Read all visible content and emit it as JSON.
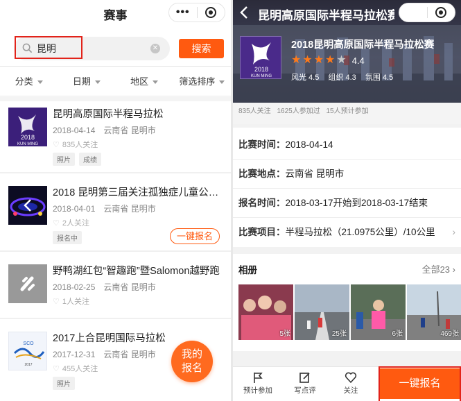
{
  "left": {
    "nav_title": "赛事",
    "capsule_more": "•••",
    "search": {
      "value": "昆明",
      "button": "搜索"
    },
    "filters": [
      "分类",
      "日期",
      "地区",
      "筛选排序"
    ],
    "events": [
      {
        "title": "昆明高原国际半程马拉松",
        "date": "2018-04-14",
        "location": "云南省 昆明市",
        "followers": "835人关注",
        "tags": [
          "照片",
          "成绩"
        ]
      },
      {
        "title": "2018 昆明第三届关注孤独症儿童公益跑",
        "date": "2018-04-01",
        "location": "云南省 昆明市",
        "followers": "2人关注",
        "tags": [
          "报名中"
        ],
        "register": "一键报名"
      },
      {
        "title": "野鸭湖红包“智趣跑”暨Salomon越野跑",
        "date": "2018-02-25",
        "location": "云南省 昆明市",
        "followers": "1人关注",
        "tags": []
      },
      {
        "title": "2017上合昆明国际马拉松",
        "date": "2017-12-31",
        "location": "云南省 昆明市",
        "followers": "455人关注",
        "tags": [
          "照片"
        ]
      }
    ],
    "fab": {
      "line1": "我的",
      "line2": "报名"
    }
  },
  "right": {
    "nav_title": "昆明高原国际半程马拉松赛",
    "logo_text": "2018\nKUN MING",
    "hero_title": "2018昆明高原国际半程马拉松赛",
    "rating": "4.4",
    "stars_full": 4,
    "subscores": [
      "风光 4.5",
      "组织 4.3",
      "氛围 4.5"
    ],
    "stats": [
      "835人关注",
      "1625人参加过",
      "15人预计参加"
    ],
    "info": [
      {
        "label": "比赛时间：",
        "value": "2018-04-14"
      },
      {
        "label": "比赛地点：",
        "value": "云南省 昆明市"
      },
      {
        "label": "报名时间：",
        "value": "2018-03-17开始到2018-03-17结束"
      },
      {
        "label": "比赛项目：",
        "value": "半程马拉松（21.0975公里）/10公里"
      }
    ],
    "album": {
      "title": "相册",
      "all": "全部23",
      "photos": [
        "5张",
        "25张",
        "6张",
        "469张"
      ]
    },
    "bottom": {
      "plan": "预计参加",
      "review": "写点评",
      "follow": "关注",
      "register": "一键报名"
    }
  },
  "colors": {
    "accent": "#ff5a10",
    "highlight": "#e2231a",
    "star": "#ff7a1a"
  }
}
